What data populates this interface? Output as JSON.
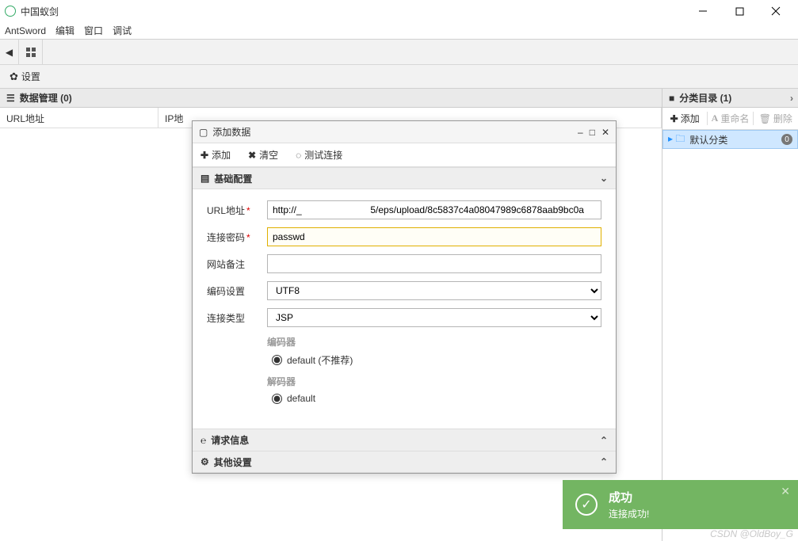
{
  "titlebar": {
    "title": "中国蚁剑"
  },
  "menubar": {
    "items": [
      "AntSword",
      "编辑",
      "窗口",
      "调试"
    ]
  },
  "settingsbar": {
    "label": "设置"
  },
  "left_panel": {
    "title": "数据管理 (0)",
    "columns": [
      "URL地址",
      "IP地"
    ]
  },
  "right_panel": {
    "title": "分类目录 (1)",
    "tools": {
      "add": "添加",
      "rename": "重命名",
      "delete": "删除"
    },
    "category": {
      "label": "默认分类",
      "count": "0"
    }
  },
  "dialog": {
    "title": "添加数据",
    "toolbar": {
      "add": "添加",
      "clear": "清空",
      "test": "测试连接"
    },
    "section_basic": "基础配置",
    "fields": {
      "url_label": "URL地址",
      "url_value": "http://_                          5/eps/upload/8c5837c4a08047989c6878aab9bc0a",
      "password_label": "连接密码",
      "password_value": "passwd",
      "note_label": "网站备注",
      "note_value": "",
      "encoding_label": "编码设置",
      "encoding_value": "UTF8",
      "conntype_label": "连接类型",
      "conntype_value": "JSP",
      "encoder_header": "编码器",
      "encoder_option": "default (不推荐)",
      "decoder_header": "解码器",
      "decoder_option": "default"
    },
    "section_request": "请求信息",
    "section_other": "其他设置"
  },
  "toast": {
    "title": "成功",
    "message": "连接成功!"
  },
  "watermark": "CSDN @OldBoy_G"
}
